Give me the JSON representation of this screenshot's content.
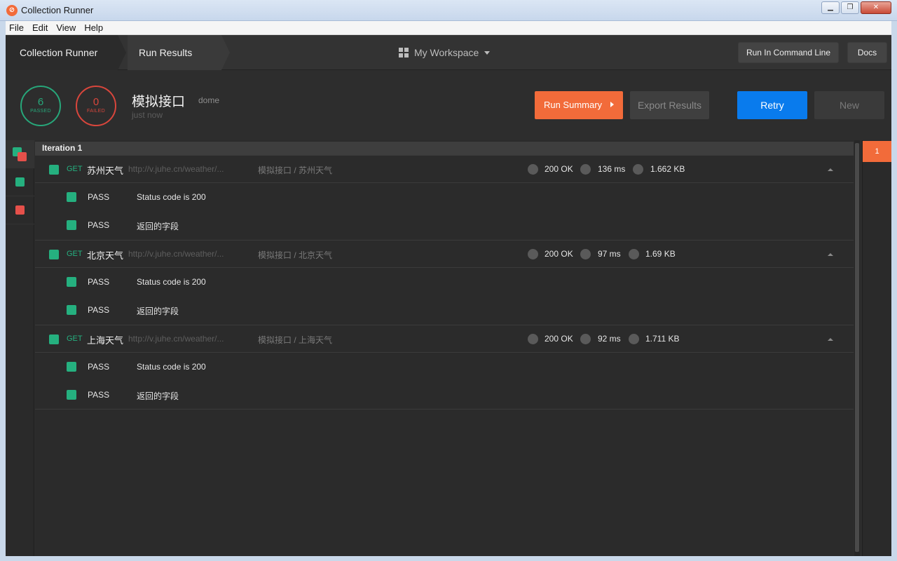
{
  "window": {
    "title": "Collection Runner",
    "minimize": "▁",
    "maximize": "❐",
    "close": "✕"
  },
  "menu": [
    "File",
    "Edit",
    "View",
    "Help"
  ],
  "breadcrumb": {
    "first": "Collection Runner",
    "second": "Run Results"
  },
  "workspace": {
    "label": "My Workspace"
  },
  "top_buttons": {
    "command_line": "Run In Command Line",
    "docs": "Docs"
  },
  "summary": {
    "passed_count": "6",
    "passed_label": "PASSED",
    "failed_count": "0",
    "failed_label": "FAILED",
    "collection_name": "模拟接口",
    "environment": "dome",
    "time": "just now"
  },
  "actions": {
    "run_summary": "Run Summary",
    "export": "Export Results",
    "retry": "Retry",
    "new": "New"
  },
  "iteration": {
    "label": "Iteration 1",
    "tracker": "1"
  },
  "requests": [
    {
      "method": "GET",
      "name": "苏州天气",
      "url": "http://v.juhe.cn/weather/...",
      "path": "模拟接口 / 苏州天气",
      "status": "200 OK",
      "time": "136 ms",
      "size": "1.662 KB",
      "tests": [
        {
          "result": "PASS",
          "name": "Status code is 200"
        },
        {
          "result": "PASS",
          "name": "返回的字段"
        }
      ]
    },
    {
      "method": "GET",
      "name": "北京天气",
      "url": "http://v.juhe.cn/weather/...",
      "path": "模拟接口 / 北京天气",
      "status": "200 OK",
      "time": "97 ms",
      "size": "1.69 KB",
      "tests": [
        {
          "result": "PASS",
          "name": "Status code is 200"
        },
        {
          "result": "PASS",
          "name": "返回的字段"
        }
      ]
    },
    {
      "method": "GET",
      "name": "上海天气",
      "url": "http://v.juhe.cn/weather/...",
      "path": "模拟接口 / 上海天气",
      "status": "200 OK",
      "time": "92 ms",
      "size": "1.711 KB",
      "tests": [
        {
          "result": "PASS",
          "name": "Status code is 200"
        },
        {
          "result": "PASS",
          "name": "返回的字段"
        }
      ]
    }
  ],
  "colors": {
    "pass": "#25b07f",
    "fail": "#e5504a",
    "accent": "#f26b3a",
    "primary": "#097bed"
  }
}
